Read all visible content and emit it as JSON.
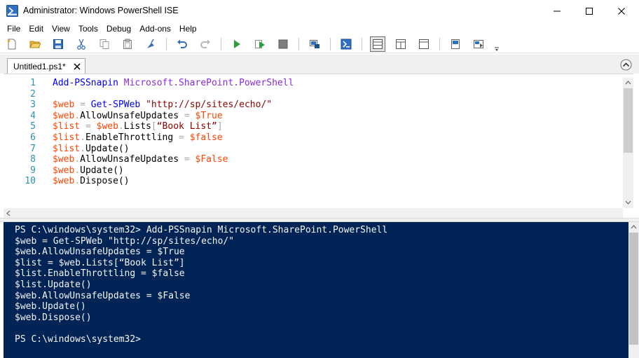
{
  "window": {
    "title": "Administrator: Windows PowerShell ISE"
  },
  "menu": [
    "File",
    "Edit",
    "View",
    "Tools",
    "Debug",
    "Add-ons",
    "Help"
  ],
  "toolbar": {
    "icons": [
      "new-file-icon",
      "open-folder-icon",
      "save-icon",
      "cut-icon",
      "copy-icon",
      "paste-icon",
      "clear-console-icon",
      "undo-icon",
      "redo-icon",
      "run-script-icon",
      "run-selection-icon",
      "stop-icon",
      "new-remote-tab-icon",
      "start-powershell-icon",
      "layout-script-top-icon",
      "layout-script-right-icon",
      "layout-script-maximized-icon",
      "show-command-window-icon",
      "show-command-addon-icon",
      "toolbar-overflow-icon"
    ]
  },
  "tab": {
    "label": "Untitled1.ps1*"
  },
  "editor": {
    "line_numbers": [
      "1",
      "2",
      "3",
      "4",
      "5",
      "6",
      "7",
      "8",
      "9",
      "10"
    ],
    "lines": [
      [
        {
          "t": "Add-PSSnapin",
          "c": "cmd"
        },
        {
          "t": " ",
          "c": "op"
        },
        {
          "t": "Microsoft.SharePoint.PowerShell",
          "c": "arg"
        }
      ],
      [],
      [
        {
          "t": "$web",
          "c": "var"
        },
        {
          "t": " = ",
          "c": "op"
        },
        {
          "t": "Get-SPWeb",
          "c": "cmd"
        },
        {
          "t": " ",
          "c": "op"
        },
        {
          "t": "\"http://sp/sites/echo/\"",
          "c": "str"
        }
      ],
      [
        {
          "t": "$web",
          "c": "var"
        },
        {
          "t": ".",
          "c": "op"
        },
        {
          "t": "AllowUnsafeUpdates",
          "c": "mem"
        },
        {
          "t": " = ",
          "c": "op"
        },
        {
          "t": "$True",
          "c": "var"
        }
      ],
      [
        {
          "t": "$list",
          "c": "var"
        },
        {
          "t": " = ",
          "c": "op"
        },
        {
          "t": "$web",
          "c": "var"
        },
        {
          "t": ".",
          "c": "op"
        },
        {
          "t": "Lists",
          "c": "mem"
        },
        {
          "t": "[",
          "c": "op"
        },
        {
          "t": "“Book List”",
          "c": "str"
        },
        {
          "t": "]",
          "c": "op"
        }
      ],
      [
        {
          "t": "$list",
          "c": "var"
        },
        {
          "t": ".",
          "c": "op"
        },
        {
          "t": "EnableThrottling",
          "c": "mem"
        },
        {
          "t": " = ",
          "c": "op"
        },
        {
          "t": "$false",
          "c": "var"
        }
      ],
      [
        {
          "t": "$list",
          "c": "var"
        },
        {
          "t": ".",
          "c": "op"
        },
        {
          "t": "Update",
          "c": "mem"
        },
        {
          "t": "()",
          "c": "par"
        }
      ],
      [
        {
          "t": "$web",
          "c": "var"
        },
        {
          "t": ".",
          "c": "op"
        },
        {
          "t": "AllowUnsafeUpdates",
          "c": "mem"
        },
        {
          "t": " = ",
          "c": "op"
        },
        {
          "t": "$False",
          "c": "var"
        }
      ],
      [
        {
          "t": "$web",
          "c": "var"
        },
        {
          "t": ".",
          "c": "op"
        },
        {
          "t": "Update",
          "c": "mem"
        },
        {
          "t": "()",
          "c": "par"
        }
      ],
      [
        {
          "t": "$web",
          "c": "var"
        },
        {
          "t": ".",
          "c": "op"
        },
        {
          "t": "Dispose",
          "c": "mem"
        },
        {
          "t": "()",
          "c": "par"
        }
      ]
    ]
  },
  "console": {
    "lines": [
      "PS C:\\windows\\system32> Add-PSSnapin Microsoft.SharePoint.PowerShell",
      "$web = Get-SPWeb \"http://sp/sites/echo/\"",
      "$web.AllowUnsafeUpdates = $True",
      "$list = $web.Lists[“Book List”]",
      "$list.EnableThrottling = $false",
      "$list.Update()",
      "$web.AllowUnsafeUpdates = $False",
      "$web.Update()",
      "$web.Dispose()",
      "",
      "PS C:\\windows\\system32>"
    ]
  },
  "colors": {
    "console_background": "#012456",
    "console_text": "#f5f5f5",
    "line_number": "#2b91af",
    "cmdlet": "#0000ff",
    "argument": "#8a2be2",
    "variable": "#ff4500",
    "string": "#8b0000",
    "operator": "#a9a9a9"
  }
}
